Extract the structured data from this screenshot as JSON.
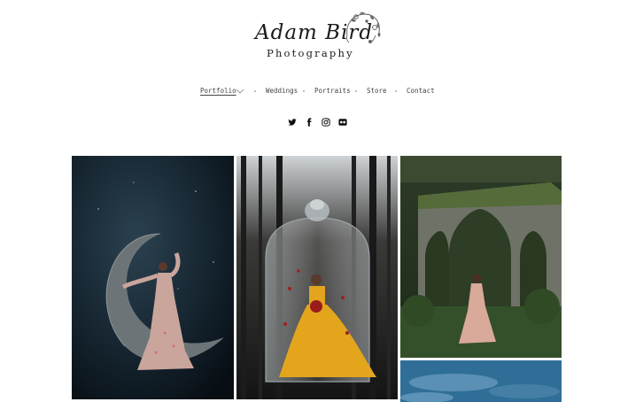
{
  "logo": {
    "script": "Adam Bird",
    "subtitle": "Photography"
  },
  "nav": {
    "items": [
      {
        "label": "Portfolio",
        "active": true,
        "has_dropdown": true
      },
      {
        "label": "Weddings"
      },
      {
        "label": "Portraits"
      },
      {
        "label": "Store"
      },
      {
        "label": "Contact"
      }
    ]
  },
  "social": [
    "twitter-icon",
    "facebook-icon",
    "instagram-icon",
    "flickr-icon"
  ],
  "gallery": [
    {
      "name": "photo-woman-on-crescent-moon"
    },
    {
      "name": "photo-woman-under-glass-bell-jar"
    },
    {
      "name": "photo-woman-in-stone-ruins"
    },
    {
      "name": "photo-blue-sky-clouds"
    }
  ]
}
